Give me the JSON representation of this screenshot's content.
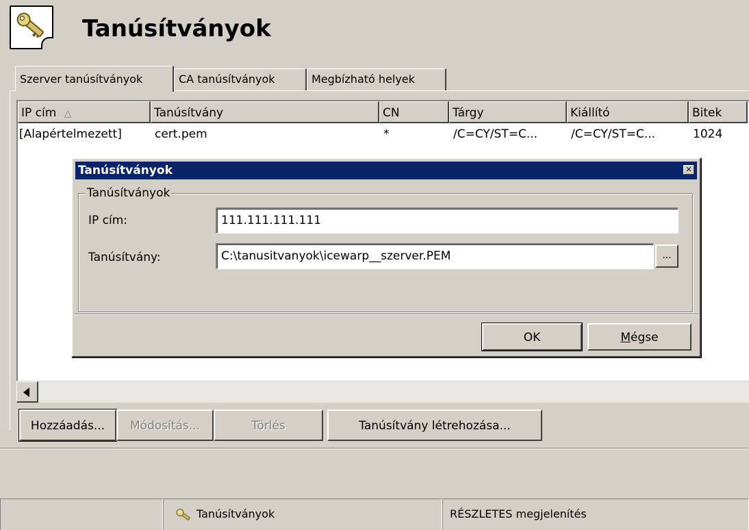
{
  "header": {
    "title": "Tanúsítványok",
    "icon": "certificate-key-icon"
  },
  "tabs": [
    {
      "label": "Szerver tanúsítványok",
      "active": true
    },
    {
      "label": "CA tanúsítványok",
      "active": false
    },
    {
      "label": "Megbízható helyek",
      "active": false
    }
  ],
  "list": {
    "columns": [
      "IP cím",
      "Tanúsítvány",
      "CN",
      "Tárgy",
      "Kiállító",
      "Bitek"
    ],
    "sort_indicator": "△",
    "rows": [
      [
        "[Alapértelmezett]",
        "cert.pem",
        "*",
        "/C=CY/ST=C...",
        "/C=CY/ST=C...",
        "1024"
      ]
    ]
  },
  "buttons": {
    "add": "Hozzáadás...",
    "edit": "Módosítás...",
    "delete": "Törlés",
    "create": "Tanúsítvány létrehozása..."
  },
  "dialog": {
    "title": "Tanúsítványok",
    "group_label": "Tanúsítványok",
    "ip_label": "IP cím:",
    "ip_value": "111.111.111.111",
    "cert_label": "Tanúsítvány:",
    "cert_value": "C:\\tanusitvanyok\\icewarp__szerver.PEM",
    "browse_label": "...",
    "ok": "OK",
    "cancel_underlined": "M",
    "cancel_rest": "égse"
  },
  "statusbar": {
    "section": "Tanúsítványok",
    "view_mode": "RÉSZLETES megjelenítés"
  },
  "colors": {
    "titlebar": "#0a246a",
    "window": "#d4d0c8"
  }
}
